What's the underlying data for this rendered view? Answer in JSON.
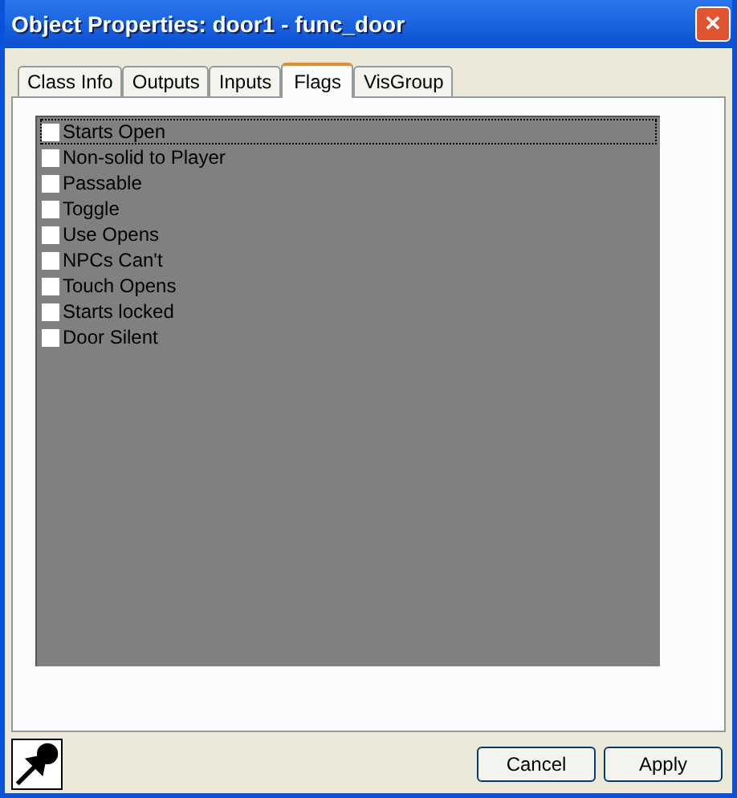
{
  "window": {
    "title": "Object Properties: door1 - func_door",
    "close": "✕"
  },
  "tabs": [
    {
      "label": "Class Info",
      "selected": false
    },
    {
      "label": "Outputs",
      "selected": false
    },
    {
      "label": "Inputs",
      "selected": false
    },
    {
      "label": "Flags",
      "selected": true
    },
    {
      "label": "VisGroup",
      "selected": false
    }
  ],
  "flags": [
    {
      "label": "Starts Open",
      "checked": false,
      "selected": true
    },
    {
      "label": "Non-solid to Player",
      "checked": false,
      "selected": false
    },
    {
      "label": "Passable",
      "checked": false,
      "selected": false
    },
    {
      "label": "Toggle",
      "checked": false,
      "selected": false
    },
    {
      "label": "Use Opens",
      "checked": false,
      "selected": false
    },
    {
      "label": "NPCs Can't",
      "checked": false,
      "selected": false
    },
    {
      "label": "Touch Opens",
      "checked": false,
      "selected": false
    },
    {
      "label": "Starts locked",
      "checked": false,
      "selected": false
    },
    {
      "label": "Door Silent",
      "checked": false,
      "selected": false
    }
  ],
  "buttons": [
    "Cancel",
    "Apply"
  ]
}
